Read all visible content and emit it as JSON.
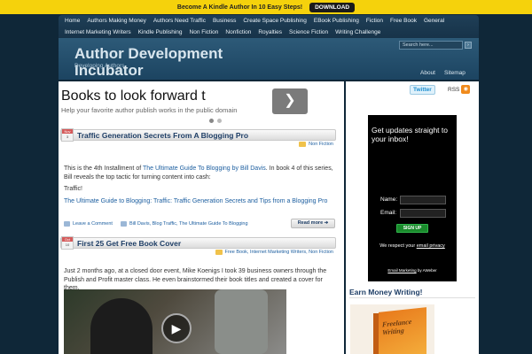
{
  "promo": {
    "text": "Become A Kindle Author In 10 Easy Steps!",
    "button": "DOWNLOAD"
  },
  "nav": {
    "row1": [
      "Home",
      "Authors Making Money",
      "Authors Need Traffic",
      "Business",
      "Create Space Publishing",
      "EBook Publishing",
      "Fiction",
      "Free Book",
      "General"
    ],
    "row2": [
      "Internet Marketing Writers",
      "Kindle Publishing",
      "Non Fiction",
      "Nonfiction",
      "Royalties",
      "Science Fiction",
      "Writing Challenge"
    ]
  },
  "header": {
    "title": "Author Development Incubator",
    "tagline": "Developing Authors",
    "search_placeholder": "Search here...",
    "about": "About",
    "sitemap": "Sitemap"
  },
  "slider": {
    "title": "Books to look forward t",
    "subtitle": "Help your favorite author publish works in the public domain"
  },
  "posts": [
    {
      "month": "Nov",
      "day": "3",
      "title": "Traffic Generation Secrets From A Blogging Pro",
      "categories": "Non Fiction",
      "p1_pre": "This is the 4th Installment of ",
      "p1_link": "The Ultimate Guide To Blogging by Bill Davis",
      "p1_post": ". In book 4 of this series, Bill reveals the top tactic for turning content into cash:",
      "p2": "Traffic!",
      "p3_link": "The Ultimate Guide to Blogging: Traffic: Traffic Generation Secrets and Tips from a Blogging Pro",
      "comment": "Leave a Comment",
      "tags": "Bill Davis, Blog Traffic, The Ultimate Guide To Blogging",
      "read_more": "Read more"
    },
    {
      "month": "Oct",
      "day": "10",
      "title": "First 25 Get Free Book Cover",
      "categories": "Free Book, Internet Marketing Writers, Non Fiction",
      "p1": "Just 2 months ago, at a closed door event, Mike Koenigs I took 39 business owners through the Publish and Profit master class. He even brainstormed their book titles and created a cover for them."
    }
  ],
  "sidebar": {
    "twitter": "Twitter",
    "rss": "RSS",
    "optin_title": "Get updates straight to your inbox!",
    "name_label": "Name:",
    "email_label": "Email:",
    "signup": "SIGN UP",
    "privacy_pre": "We respect your ",
    "privacy_link": "email privacy",
    "footer_link": "Email Marketing",
    "footer_post": " by AWeber",
    "heading": "Earn Money Writing!",
    "book_text": "Freelance Writing"
  },
  "colors": {
    "promo_bg": "#f5d20c",
    "nav_bg": "#1f3f57",
    "link": "#1d5fa0",
    "title": "#1e3e66"
  }
}
